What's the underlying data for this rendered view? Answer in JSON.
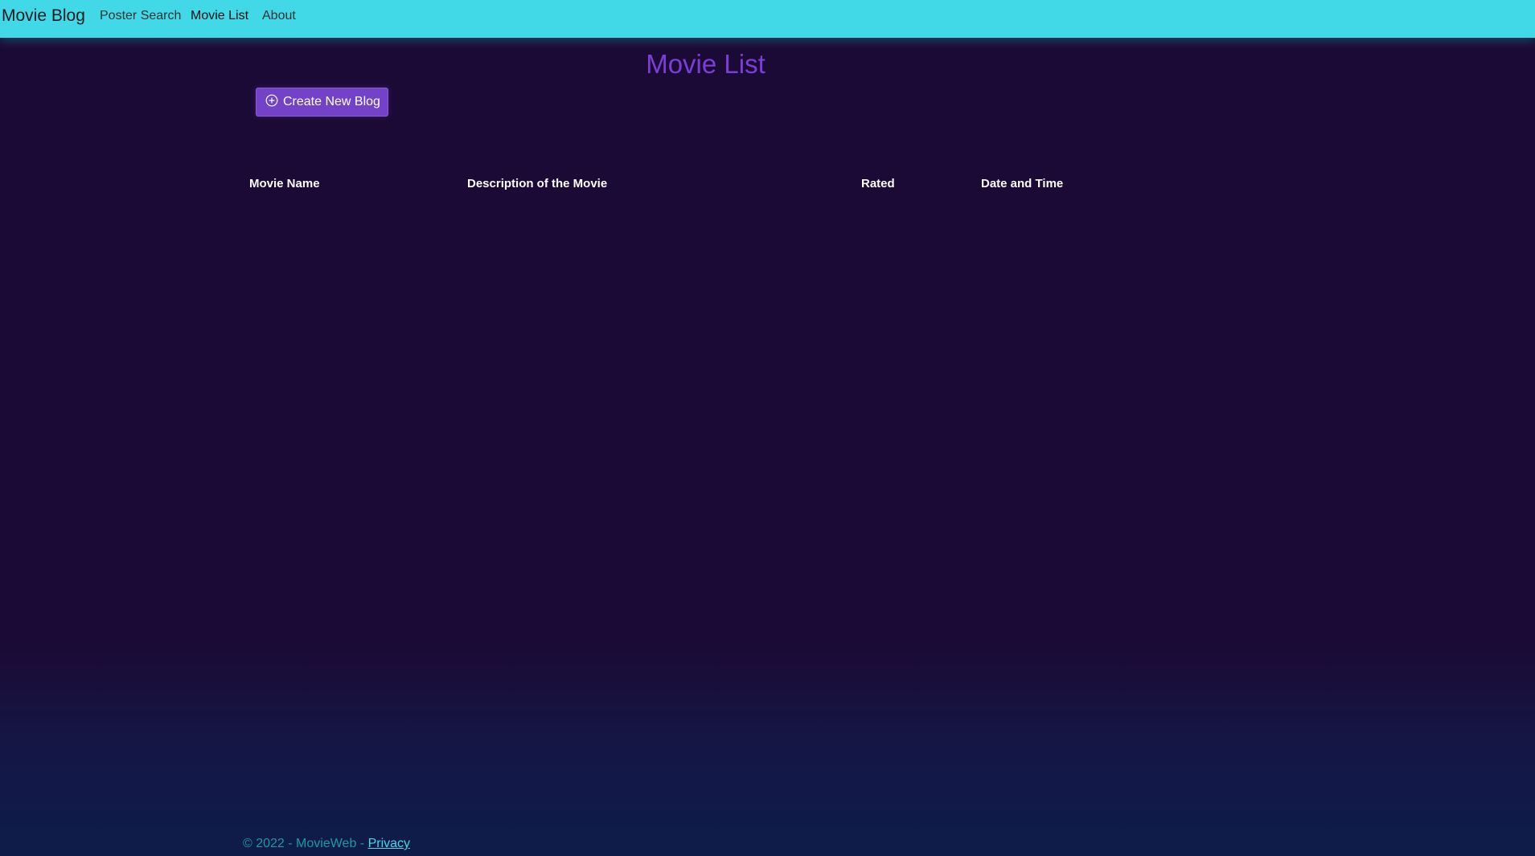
{
  "navbar": {
    "brand": "Movie Blog",
    "links": [
      "Poster Search",
      "Movie List",
      "About"
    ],
    "background": "#41d8e8"
  },
  "page": {
    "title": "Movie List",
    "background": "#1b0a35",
    "accent": "#7b3fd8"
  },
  "create_button": {
    "label": "Create New Blog",
    "icon": "plus-circle-icon",
    "color": "#7442c9"
  },
  "table": {
    "headers": [
      "Movie Name",
      "Description of the Movie",
      "Rated",
      "Date and Time"
    ],
    "rows": []
  },
  "footer": {
    "text": "© 2022 - MovieWeb - ",
    "link": "Privacy"
  }
}
